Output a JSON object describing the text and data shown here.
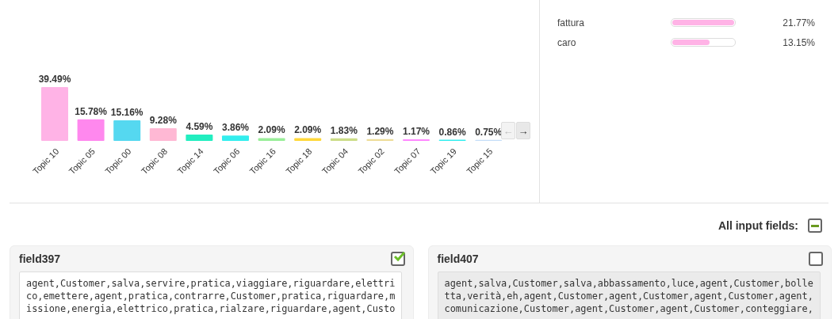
{
  "topics_chart": {
    "chart_data": {
      "type": "bar",
      "categories": [
        "Topic 10",
        "Topic 05",
        "Topic 00",
        "Topic 08",
        "Topic 14",
        "Topic 06",
        "Topic 16",
        "Topic 18",
        "Topic 04",
        "Topic 02",
        "Topic 07",
        "Topic 19",
        "Topic 15"
      ],
      "values": [
        39.49,
        15.78,
        15.16,
        9.28,
        4.59,
        3.86,
        2.09,
        2.09,
        1.83,
        1.29,
        1.17,
        0.86,
        0.75
      ],
      "value_labels": [
        "39.49%",
        "15.78%",
        "15.16%",
        "9.28%",
        "4.59%",
        "3.86%",
        "2.09%",
        "2.09%",
        "1.83%",
        "1.29%",
        "1.17%",
        "0.86%",
        "0.75%"
      ]
    },
    "bars": [
      {
        "color": "#ffb3e6"
      },
      {
        "color": "#ff88ee"
      },
      {
        "color": "#55d8f0"
      },
      {
        "color": "#ffb8d4"
      },
      {
        "color": "#22eec0"
      },
      {
        "color": "#33eeee"
      },
      {
        "color": "#99ee99"
      },
      {
        "color": "#ffd83a"
      },
      {
        "color": "#ccdd88"
      },
      {
        "color": "#eedd99"
      },
      {
        "color": "#ff88ff"
      },
      {
        "color": "#33eeef"
      },
      {
        "color": "#c4ddf8"
      }
    ],
    "nav": [
      {
        "label": "←",
        "disabled": true
      },
      {
        "label": "→",
        "disabled": false
      }
    ]
  },
  "keywords": [
    {
      "word": "fattura",
      "level": 1.0,
      "percent": "21.77%"
    },
    {
      "word": "caro",
      "level": 0.6,
      "percent": "13.15%"
    }
  ],
  "all_input_fields": {
    "label": "All input fields:",
    "indeterminate": true
  },
  "fields": [
    {
      "name": "field397",
      "checked": true,
      "value": "agent,Customer,salva,servire,pratica,viaggiare,riguardare,elettrico,emettere,agent,pratica,contrarre,Customer,pratica,riguardare,missione,energia,elettrico,pratica,rialzare,riguardare,agent,Custo"
    },
    {
      "name": "field407",
      "checked": false,
      "value": "agent,salva,Customer,salva,abbassamento,luce,agent,Customer,bolletta,verità,eh,agent,Customer,agent,Customer,agent,Customer,agent,comunicazione,Customer,agent,Customer,agent,Customer,conteggiare,"
    }
  ]
}
